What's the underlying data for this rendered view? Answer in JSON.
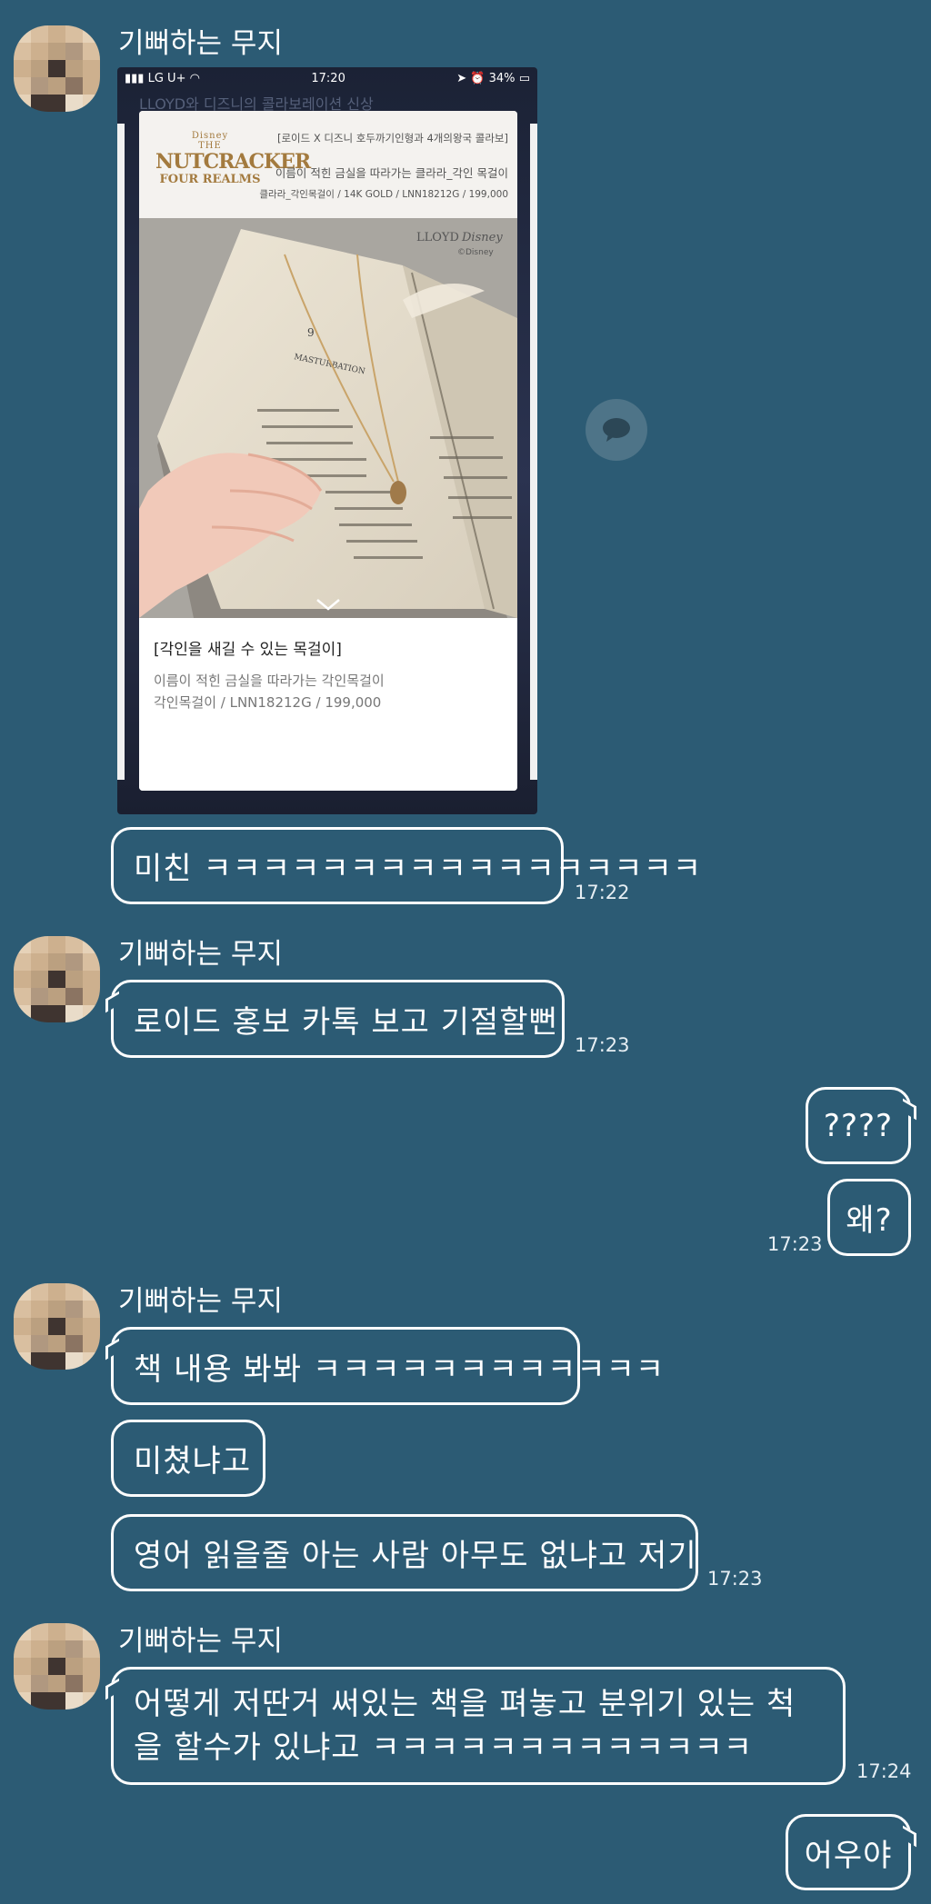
{
  "sender_name": "기뻐하는 무지",
  "shared_image": {
    "status_carrier": "LG U+",
    "status_time": "17:20",
    "status_battery": "34%",
    "ghost_text": "LLOYD와 디즈니의 콜라보레이션 신상",
    "logo_disney": "Disney",
    "logo_the": "THE",
    "logo_title": "NUTCRACKER",
    "logo_sub": "FOUR REALMS",
    "header_line1": "[로이드 X 디즈니 호두까기인형과 4개의왕국 콜라보]",
    "header_line2": "이름이 적힌 금실을 따라가는 클라라_각인 목걸이",
    "header_line3": "클라라_각인목걸이 / 14K GOLD / LNN18212G / 199,000",
    "brand_lloyd": "LLOYD",
    "brand_disney": "Disney",
    "brand_copy": "©Disney",
    "page_number": "9",
    "page_heading": "MASTURBATION",
    "card_title": "[각인을 새길 수 있는 목걸이]",
    "card_line1": "이름이 적힌 금실을 따라가는 각인목걸이",
    "card_line2": "각인목걸이 / LNN18212G / 199,000"
  },
  "messages": [
    {
      "text": "미친 ㅋㅋㅋㅋㅋㅋㅋㅋㅋㅋㅋㅋㅋㅋㅋㅋㅋ",
      "time": "17:22"
    },
    {
      "text": "로이드 홍보 카톡 보고 기절할뻔",
      "time": "17:23"
    },
    {
      "text": "????"
    },
    {
      "text": "왜?",
      "time": "17:23"
    },
    {
      "text": "책 내용 봐봐 ㅋㅋㅋㅋㅋㅋㅋㅋㅋㅋㅋㅋ"
    },
    {
      "text": "미쳤냐고"
    },
    {
      "text": "영어 읽을줄 아는 사람 아무도 없냐고 저기",
      "time": "17:23"
    },
    {
      "text": "어떻게 저딴거 써있는 책을 펴놓고 분위기 있는 척을 할수가 있냐고 ㅋㅋㅋㅋㅋㅋㅋㅋㅋㅋㅋㅋㅋ",
      "time": "17:24"
    },
    {
      "text": "어우야"
    }
  ],
  "colors": {
    "background": "#2c5b74",
    "bubble_border": "#ffffff"
  }
}
